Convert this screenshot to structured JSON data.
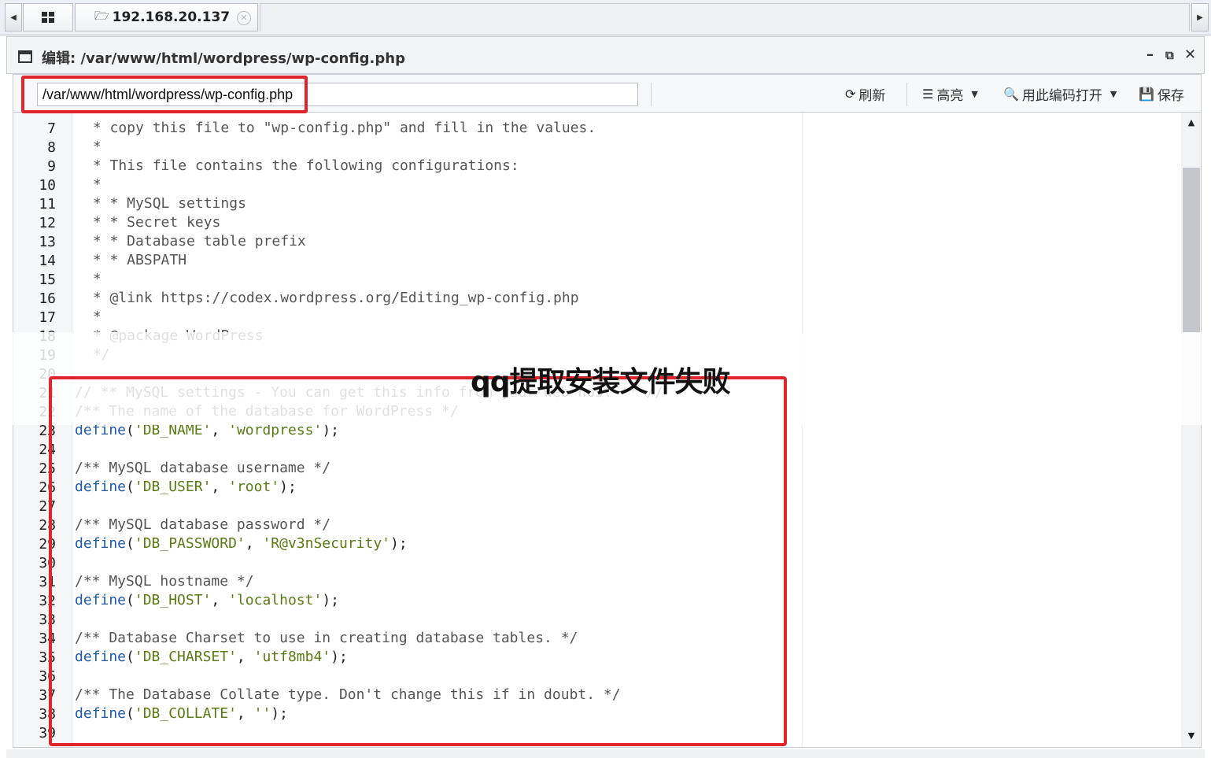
{
  "tabs": {
    "host_label": "192.168.20.137"
  },
  "window": {
    "title": "编辑: /var/www/html/wordpress/wp-config.php"
  },
  "toolbar": {
    "path_value": "/var/www/html/wordpress/wp-config.php",
    "refresh_label": "刷新",
    "highlight_label": "高亮",
    "open_encoding_label": "用此编码打开",
    "save_label": "保存"
  },
  "caption": "qq提取安装文件失败",
  "code": {
    "lines": [
      {
        "n": "7",
        "text": " * copy this file to \"wp-config.php\" and fill in the values."
      },
      {
        "n": "8",
        "text": " *"
      },
      {
        "n": "9",
        "text": " * This file contains the following configurations:"
      },
      {
        "n": "10",
        "text": " *"
      },
      {
        "n": "11",
        "text": " * * MySQL settings"
      },
      {
        "n": "12",
        "text": " * * Secret keys"
      },
      {
        "n": "13",
        "text": " * * Database table prefix"
      },
      {
        "n": "14",
        "text": " * * ABSPATH"
      },
      {
        "n": "15",
        "text": " *"
      },
      {
        "n": "16",
        "text": " * @link https://codex.wordpress.org/Editing_wp-config.php"
      },
      {
        "n": "17",
        "text": " *"
      },
      {
        "n": "18",
        "text": " * @package WordPress"
      },
      {
        "n": "19",
        "text": " */"
      },
      {
        "n": "20",
        "text": ""
      },
      {
        "n": "21",
        "text": "// ** MySQL settings - You can get this info from your web host ** //"
      },
      {
        "n": "22",
        "text": "/** The name of the database for WordPress */"
      },
      {
        "n": "23",
        "fn": "define",
        "key": "'DB_NAME'",
        "val": "'wordpress'"
      },
      {
        "n": "24",
        "text": ""
      },
      {
        "n": "25",
        "text": "/** MySQL database username */"
      },
      {
        "n": "26",
        "fn": "define",
        "key": "'DB_USER'",
        "val": "'root'"
      },
      {
        "n": "27",
        "text": ""
      },
      {
        "n": "28",
        "text": "/** MySQL database password */"
      },
      {
        "n": "29",
        "fn": "define",
        "key": "'DB_PASSWORD'",
        "val": "'R@v3nSecurity'"
      },
      {
        "n": "30",
        "text": ""
      },
      {
        "n": "31",
        "text": "/** MySQL hostname */"
      },
      {
        "n": "32",
        "fn": "define",
        "key": "'DB_HOST'",
        "val": "'localhost'"
      },
      {
        "n": "33",
        "text": ""
      },
      {
        "n": "34",
        "text": "/** Database Charset to use in creating database tables. */"
      },
      {
        "n": "35",
        "fn": "define",
        "key": "'DB_CHARSET'",
        "val": "'utf8mb4'"
      },
      {
        "n": "36",
        "text": ""
      },
      {
        "n": "37",
        "text": "/** The Database Collate type. Don't change this if in doubt. */"
      },
      {
        "n": "38",
        "fn": "define",
        "key": "'DB_COLLATE'",
        "val": "''"
      },
      {
        "n": "39",
        "text": ""
      }
    ]
  },
  "colors": {
    "highlight_box": "#e0262b",
    "keyword": "#1e5aa8",
    "string": "#5a7a12"
  }
}
